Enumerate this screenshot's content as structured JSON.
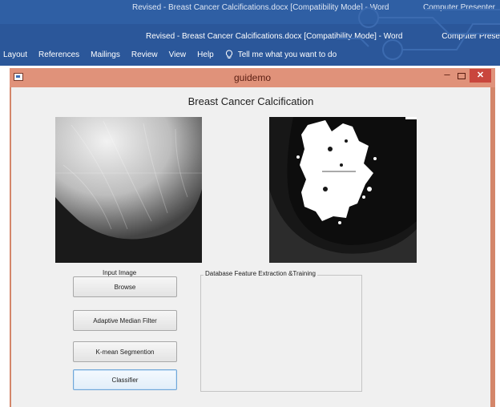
{
  "word": {
    "title_faded": "Revised - Breast Cancer Calcifications.docx [Compatibility Mode]  -  Word",
    "right_faded": "Computer Presenter",
    "title": "Revised - Breast Cancer Calcifications.docx [Compatibility Mode]  -  Word",
    "right_label": "Computer Prese",
    "menu": [
      "Layout",
      "References",
      "Mailings",
      "Review",
      "View",
      "Help"
    ],
    "tell_me": "Tell me what you want to do"
  },
  "window": {
    "title": "guidemo",
    "min_label": "–",
    "close_label": "✕"
  },
  "app": {
    "heading": "Breast Cancer Calcification",
    "input_caption": "Input Image",
    "buttons": {
      "browse": "Browse",
      "median": "Adaptive Median Filter",
      "kmean": "K-mean Segmention",
      "classifier": "Classifier"
    },
    "group_title": "Database Feature Extraction &Training"
  },
  "colors": {
    "ribbon": "#2b579a",
    "window_frame": "#d4866a",
    "close": "#c9463d"
  },
  "icons": [
    "app-icon",
    "lightbulb-icon",
    "minimize-icon",
    "maximize-icon",
    "close-icon"
  ]
}
